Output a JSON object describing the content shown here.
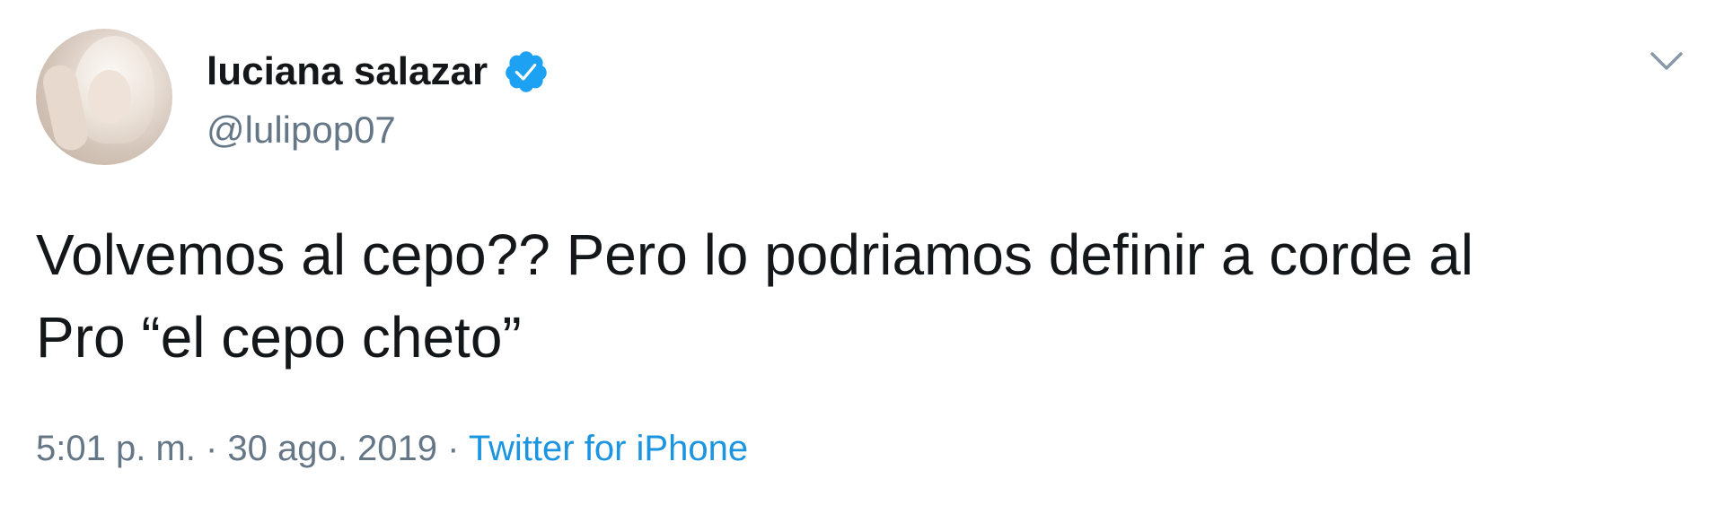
{
  "user": {
    "display_name": "luciana salazar",
    "handle": "@lulipop07",
    "verified": true
  },
  "tweet": {
    "text": "Volvemos al cepo?? Pero lo podriamos definir a corde al\nPro “el cepo cheto”",
    "time": "5:01 p. m.",
    "separator1": " · ",
    "date": "30 ago. 2019",
    "separator2": " · ",
    "source": "Twitter for iPhone"
  },
  "colors": {
    "verified_badge": "#1da1f2",
    "link": "#1b95e0",
    "secondary_text": "#657786",
    "primary_text": "#14171a"
  },
  "icons": {
    "verified": "verified-badge-icon",
    "caret": "chevron-down-icon"
  }
}
